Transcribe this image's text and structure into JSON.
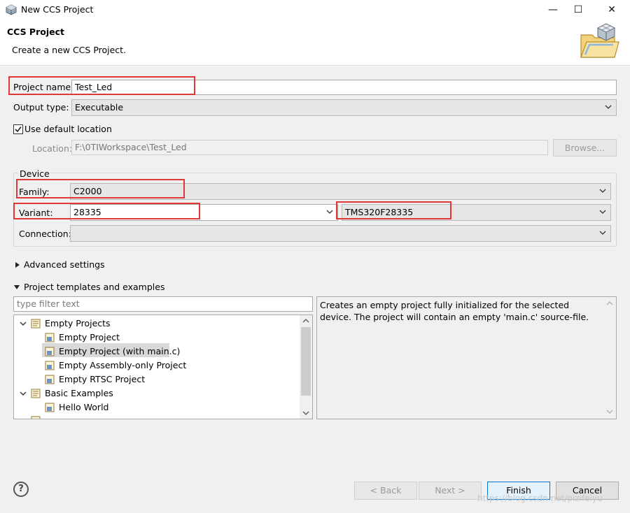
{
  "window": {
    "title": "New CCS Project",
    "minimize_glyph": "—",
    "maximize_glyph": "☐",
    "close_glyph": "✕"
  },
  "header": {
    "title": "CCS Project",
    "subtitle": "Create a new CCS Project."
  },
  "form": {
    "project_name_label": "Project name:",
    "project_name_value": "Test_Led",
    "output_type_label": "Output type:",
    "output_type_value": "Executable",
    "use_default_location_label": "Use default location",
    "use_default_location_checked": true,
    "location_label": "Location:",
    "location_value": "F:\\0TIWorkspace\\Test_Led",
    "browse_label": "Browse..."
  },
  "device": {
    "group_label": "Device",
    "family_label": "Family:",
    "family_value": "C2000",
    "variant_label": "Variant:",
    "variant_filter_value": "28335",
    "variant_value": "TMS320F28335",
    "connection_label": "Connection:",
    "connection_value": ""
  },
  "sections": {
    "advanced_label": "Advanced settings",
    "templates_label": "Project templates and examples"
  },
  "templates": {
    "filter_placeholder": "type filter text",
    "tree": [
      {
        "label": "Empty Projects",
        "level": 0,
        "expanded": true
      },
      {
        "label": "Empty Project",
        "level": 1
      },
      {
        "label": "Empty Project (with main.c)",
        "level": 1,
        "selected": true
      },
      {
        "label": "Empty Assembly-only Project",
        "level": 1
      },
      {
        "label": "Empty RTSC Project",
        "level": 1
      },
      {
        "label": "Basic Examples",
        "level": 0,
        "expanded": true
      },
      {
        "label": "Hello World",
        "level": 1
      }
    ],
    "description": "Creates an empty project fully initialized for the selected device. The project will contain an empty 'main.c' source-file."
  },
  "buttons": {
    "help_glyph": "?",
    "back": "< Back",
    "next": "Next >",
    "finish": "Finish",
    "cancel": "Cancel"
  },
  "watermark": "https://blog.csdn.net/pizifeiyu",
  "colors": {
    "highlight_box": "#e23737",
    "selection": "#d9d9d9",
    "default_button_border": "#0078d7"
  }
}
